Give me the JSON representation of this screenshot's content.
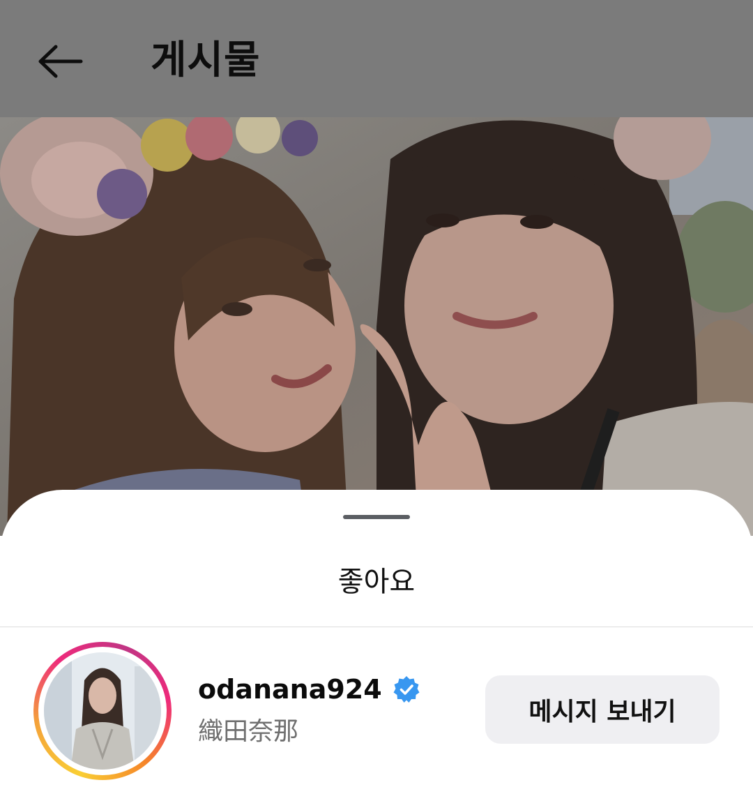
{
  "header": {
    "title": "게시물",
    "back_icon": "back-arrow-icon"
  },
  "photo": {
    "description_icon": "post-photo"
  },
  "sheet": {
    "title": "좋아요"
  },
  "likes": [
    {
      "username": "odanana924",
      "full_name": "織田奈那",
      "verified": true,
      "action_label": "메시지 보내기"
    }
  ],
  "colors": {
    "verified_badge": "#3897f0",
    "button_bg": "#efeff2",
    "topbar_dim": "#7b7b7b"
  }
}
